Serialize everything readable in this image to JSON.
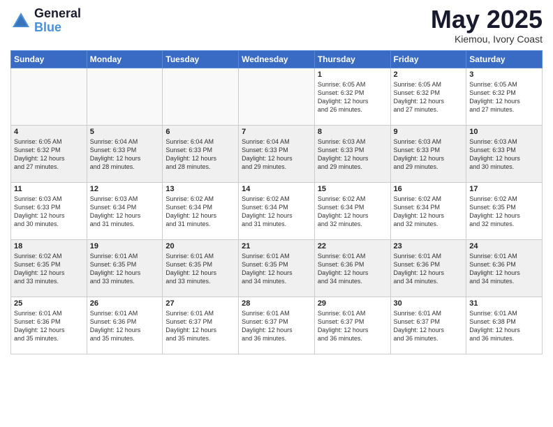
{
  "header": {
    "logo_line1": "General",
    "logo_line2": "Blue",
    "month": "May 2025",
    "location": "Kiemou, Ivory Coast"
  },
  "days_of_week": [
    "Sunday",
    "Monday",
    "Tuesday",
    "Wednesday",
    "Thursday",
    "Friday",
    "Saturday"
  ],
  "weeks": [
    [
      {
        "day": "",
        "empty": true
      },
      {
        "day": "",
        "empty": true
      },
      {
        "day": "",
        "empty": true
      },
      {
        "day": "",
        "empty": true
      },
      {
        "day": "1",
        "sunrise": "6:05 AM",
        "sunset": "6:32 PM",
        "daylight": "12 hours and 26 minutes."
      },
      {
        "day": "2",
        "sunrise": "6:05 AM",
        "sunset": "6:32 PM",
        "daylight": "12 hours and 27 minutes."
      },
      {
        "day": "3",
        "sunrise": "6:05 AM",
        "sunset": "6:32 PM",
        "daylight": "12 hours and 27 minutes."
      }
    ],
    [
      {
        "day": "4",
        "sunrise": "6:05 AM",
        "sunset": "6:32 PM",
        "daylight": "12 hours and 27 minutes."
      },
      {
        "day": "5",
        "sunrise": "6:04 AM",
        "sunset": "6:33 PM",
        "daylight": "12 hours and 28 minutes."
      },
      {
        "day": "6",
        "sunrise": "6:04 AM",
        "sunset": "6:33 PM",
        "daylight": "12 hours and 28 minutes."
      },
      {
        "day": "7",
        "sunrise": "6:04 AM",
        "sunset": "6:33 PM",
        "daylight": "12 hours and 29 minutes."
      },
      {
        "day": "8",
        "sunrise": "6:03 AM",
        "sunset": "6:33 PM",
        "daylight": "12 hours and 29 minutes."
      },
      {
        "day": "9",
        "sunrise": "6:03 AM",
        "sunset": "6:33 PM",
        "daylight": "12 hours and 29 minutes."
      },
      {
        "day": "10",
        "sunrise": "6:03 AM",
        "sunset": "6:33 PM",
        "daylight": "12 hours and 30 minutes."
      }
    ],
    [
      {
        "day": "11",
        "sunrise": "6:03 AM",
        "sunset": "6:33 PM",
        "daylight": "12 hours and 30 minutes."
      },
      {
        "day": "12",
        "sunrise": "6:03 AM",
        "sunset": "6:34 PM",
        "daylight": "12 hours and 31 minutes."
      },
      {
        "day": "13",
        "sunrise": "6:02 AM",
        "sunset": "6:34 PM",
        "daylight": "12 hours and 31 minutes."
      },
      {
        "day": "14",
        "sunrise": "6:02 AM",
        "sunset": "6:34 PM",
        "daylight": "12 hours and 31 minutes."
      },
      {
        "day": "15",
        "sunrise": "6:02 AM",
        "sunset": "6:34 PM",
        "daylight": "12 hours and 32 minutes."
      },
      {
        "day": "16",
        "sunrise": "6:02 AM",
        "sunset": "6:34 PM",
        "daylight": "12 hours and 32 minutes."
      },
      {
        "day": "17",
        "sunrise": "6:02 AM",
        "sunset": "6:35 PM",
        "daylight": "12 hours and 32 minutes."
      }
    ],
    [
      {
        "day": "18",
        "sunrise": "6:02 AM",
        "sunset": "6:35 PM",
        "daylight": "12 hours and 33 minutes."
      },
      {
        "day": "19",
        "sunrise": "6:01 AM",
        "sunset": "6:35 PM",
        "daylight": "12 hours and 33 minutes."
      },
      {
        "day": "20",
        "sunrise": "6:01 AM",
        "sunset": "6:35 PM",
        "daylight": "12 hours and 33 minutes."
      },
      {
        "day": "21",
        "sunrise": "6:01 AM",
        "sunset": "6:35 PM",
        "daylight": "12 hours and 34 minutes."
      },
      {
        "day": "22",
        "sunrise": "6:01 AM",
        "sunset": "6:36 PM",
        "daylight": "12 hours and 34 minutes."
      },
      {
        "day": "23",
        "sunrise": "6:01 AM",
        "sunset": "6:36 PM",
        "daylight": "12 hours and 34 minutes."
      },
      {
        "day": "24",
        "sunrise": "6:01 AM",
        "sunset": "6:36 PM",
        "daylight": "12 hours and 34 minutes."
      }
    ],
    [
      {
        "day": "25",
        "sunrise": "6:01 AM",
        "sunset": "6:36 PM",
        "daylight": "12 hours and 35 minutes."
      },
      {
        "day": "26",
        "sunrise": "6:01 AM",
        "sunset": "6:36 PM",
        "daylight": "12 hours and 35 minutes."
      },
      {
        "day": "27",
        "sunrise": "6:01 AM",
        "sunset": "6:37 PM",
        "daylight": "12 hours and 35 minutes."
      },
      {
        "day": "28",
        "sunrise": "6:01 AM",
        "sunset": "6:37 PM",
        "daylight": "12 hours and 36 minutes."
      },
      {
        "day": "29",
        "sunrise": "6:01 AM",
        "sunset": "6:37 PM",
        "daylight": "12 hours and 36 minutes."
      },
      {
        "day": "30",
        "sunrise": "6:01 AM",
        "sunset": "6:37 PM",
        "daylight": "12 hours and 36 minutes."
      },
      {
        "day": "31",
        "sunrise": "6:01 AM",
        "sunset": "6:38 PM",
        "daylight": "12 hours and 36 minutes."
      }
    ]
  ]
}
